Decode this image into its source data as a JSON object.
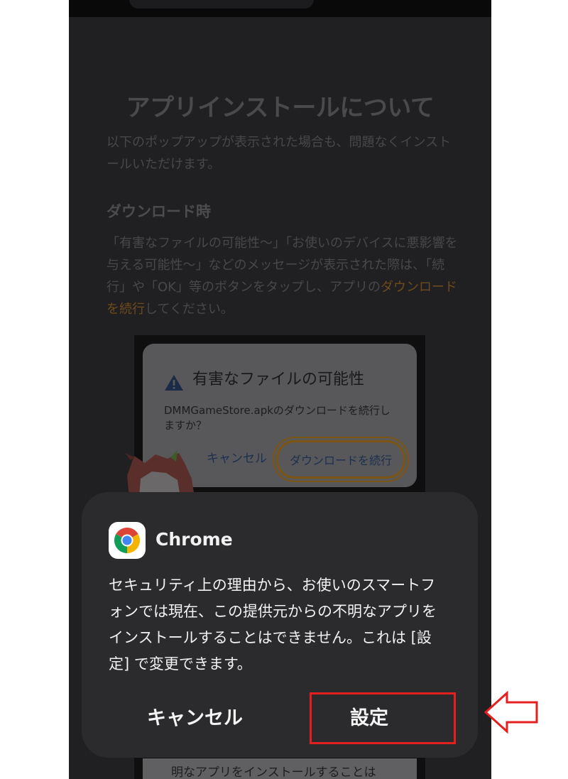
{
  "page": {
    "title": "アプリインストールについて",
    "intro": "以下のポップアップが表示された場合も、問題なくインストールいただけます。",
    "download_heading": "ダウンロード時",
    "download_text": "「有害なファイルの可能性〜」「お使いのデバイスに悪影響を与える可能性〜」などのメッセージが表示された際は、「続行」や「OK」等のボタンをタップし、アプリの",
    "download_link": "ダウンロードを続行",
    "download_suffix": "してください。"
  },
  "example": {
    "dialog_title": "有害なファイルの可能性",
    "dialog_body": "DMMGameStore.apkのダウンロードを続行しますか？",
    "cancel_label": "キャンセル",
    "continue_label": "ダウンロードを続行",
    "bottom_text": "明なアプリをインストールすることは"
  },
  "sheet": {
    "app_name": "Chrome",
    "message": "セキュリティ上の理由から、お使いのスマートフォンでは現在、この提供元からの不明なアプリをインストールすることはできません。これは [設定] で変更できます。",
    "cancel_label": "キャンセル",
    "settings_label": "設定"
  },
  "colors": {
    "highlight": "#e41f1f",
    "link": "#6e4b1c"
  }
}
